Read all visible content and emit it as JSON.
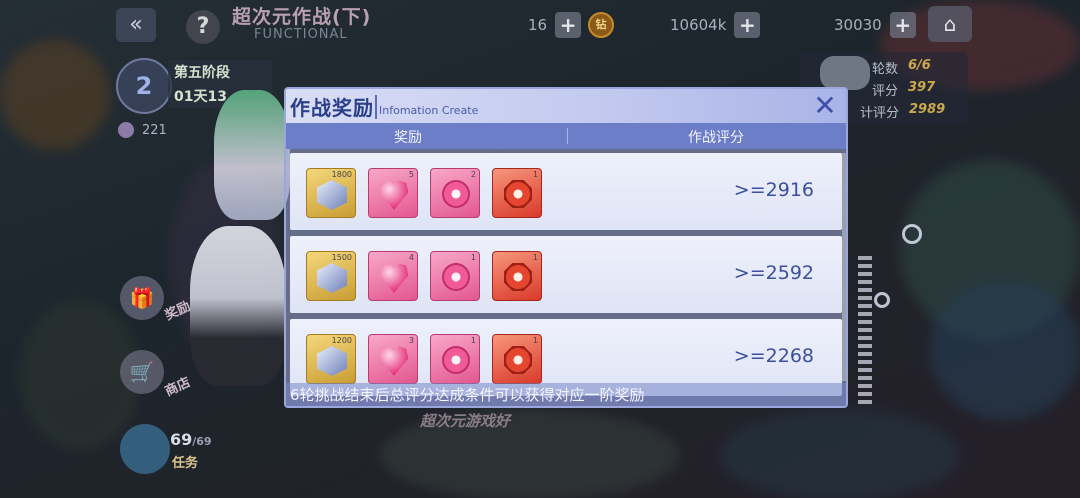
{
  "header": {
    "title": "超次元作战(下)",
    "subtitle": "FUNCTIONAL",
    "back_icon": "«",
    "help_icon": "?",
    "home_icon": "⌂",
    "resources": [
      {
        "value": "16",
        "plus": "+"
      },
      {
        "value": "10604k",
        "plus": "+",
        "coin": "钻"
      },
      {
        "value": "30030",
        "plus": "+"
      }
    ]
  },
  "left_panel": {
    "stage_badge": "2",
    "stage_label": "第五阶段",
    "stage_time": "01天13",
    "gem_count": "221"
  },
  "side_menu": [
    {
      "label": "奖励",
      "icon": "🎁"
    },
    {
      "label": "商店",
      "icon": "🛒"
    }
  ],
  "task": {
    "current": "69",
    "max": "/69",
    "label": "任务"
  },
  "score_panel": {
    "rounds_label": "轮数",
    "rounds_value": "6/6",
    "score_label": "评分",
    "score_value": "397",
    "total_label": "计评分",
    "total_value": "2989"
  },
  "modal": {
    "title": "作战奖励",
    "subtitle": "Infomation Create",
    "close_icon": "✕",
    "col_reward": "奖励",
    "col_score": "作战评分",
    "rows": [
      {
        "score": ">=2916",
        "items": [
          {
            "type": "gold",
            "icon": "crystal-icon",
            "count": "1800"
          },
          {
            "type": "pink",
            "icon": "heart-gem-icon",
            "count": "5"
          },
          {
            "type": "pink",
            "icon": "flower-badge-icon",
            "count": "2"
          },
          {
            "type": "red",
            "icon": "crest-icon",
            "count": "1"
          }
        ]
      },
      {
        "score": ">=2592",
        "items": [
          {
            "type": "gold",
            "icon": "crystal-icon",
            "count": "1500"
          },
          {
            "type": "pink",
            "icon": "heart-gem-icon",
            "count": "4"
          },
          {
            "type": "pink",
            "icon": "flower-badge-icon",
            "count": "1"
          },
          {
            "type": "red",
            "icon": "crest-icon",
            "count": "1"
          }
        ]
      },
      {
        "score": ">=2268",
        "items": [
          {
            "type": "gold",
            "icon": "crystal-icon",
            "count": "1200"
          },
          {
            "type": "pink",
            "icon": "heart-gem-icon",
            "count": "3"
          },
          {
            "type": "pink",
            "icon": "flower-badge-icon",
            "count": "1"
          },
          {
            "type": "red",
            "icon": "crest-icon",
            "count": "1"
          }
        ]
      }
    ],
    "footer": "6轮挑战结束后总评分达成条件可以获得对应一阶奖励"
  },
  "bottom_banner": "超次元游戏好"
}
